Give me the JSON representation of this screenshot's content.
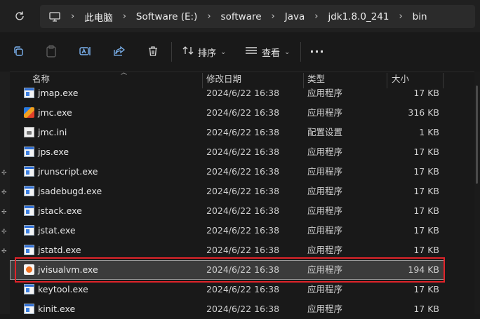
{
  "address": {
    "crumbs": [
      "此电脑",
      "Software (E:)",
      "software",
      "Java",
      "jdk1.8.0_241",
      "bin"
    ]
  },
  "toolbar": {
    "icons": [
      "copy-icon",
      "paste-icon",
      "rename-icon",
      "share-icon",
      "delete-icon"
    ],
    "sort_label": "排序",
    "view_label": "查看",
    "more_label": "···"
  },
  "columns": {
    "name": "名称",
    "date": "修改日期",
    "type": "类型",
    "size": "大小"
  },
  "files": [
    {
      "name": "jmap.exe",
      "date": "2024/6/22 16:38",
      "type": "应用程序",
      "size": "17 KB",
      "icon": "exe"
    },
    {
      "name": "jmc.exe",
      "date": "2024/6/22 16:38",
      "type": "应用程序",
      "size": "316 KB",
      "icon": "color"
    },
    {
      "name": "jmc.ini",
      "date": "2024/6/22 16:38",
      "type": "配置设置",
      "size": "1 KB",
      "icon": "ini"
    },
    {
      "name": "jps.exe",
      "date": "2024/6/22 16:38",
      "type": "应用程序",
      "size": "17 KB",
      "icon": "exe"
    },
    {
      "name": "jrunscript.exe",
      "date": "2024/6/22 16:38",
      "type": "应用程序",
      "size": "17 KB",
      "icon": "exe"
    },
    {
      "name": "jsadebugd.exe",
      "date": "2024/6/22 16:38",
      "type": "应用程序",
      "size": "17 KB",
      "icon": "exe"
    },
    {
      "name": "jstack.exe",
      "date": "2024/6/22 16:38",
      "type": "应用程序",
      "size": "17 KB",
      "icon": "exe"
    },
    {
      "name": "jstat.exe",
      "date": "2024/6/22 16:38",
      "type": "应用程序",
      "size": "17 KB",
      "icon": "exe"
    },
    {
      "name": "jstatd.exe",
      "date": "2024/6/22 16:38",
      "type": "应用程序",
      "size": "17 KB",
      "icon": "exe"
    },
    {
      "name": "jvisualvm.exe",
      "date": "2024/6/22 16:38",
      "type": "应用程序",
      "size": "194 KB",
      "icon": "vm",
      "selected": true
    },
    {
      "name": "keytool.exe",
      "date": "2024/6/22 16:38",
      "type": "应用程序",
      "size": "17 KB",
      "icon": "exe"
    },
    {
      "name": "kinit.exe",
      "date": "2024/6/22 16:38",
      "type": "应用程序",
      "size": "17 KB",
      "icon": "exe"
    }
  ],
  "colors": {
    "accent": "#7cb3f0",
    "highlight_box": "#e0242a",
    "background": "#191919"
  }
}
